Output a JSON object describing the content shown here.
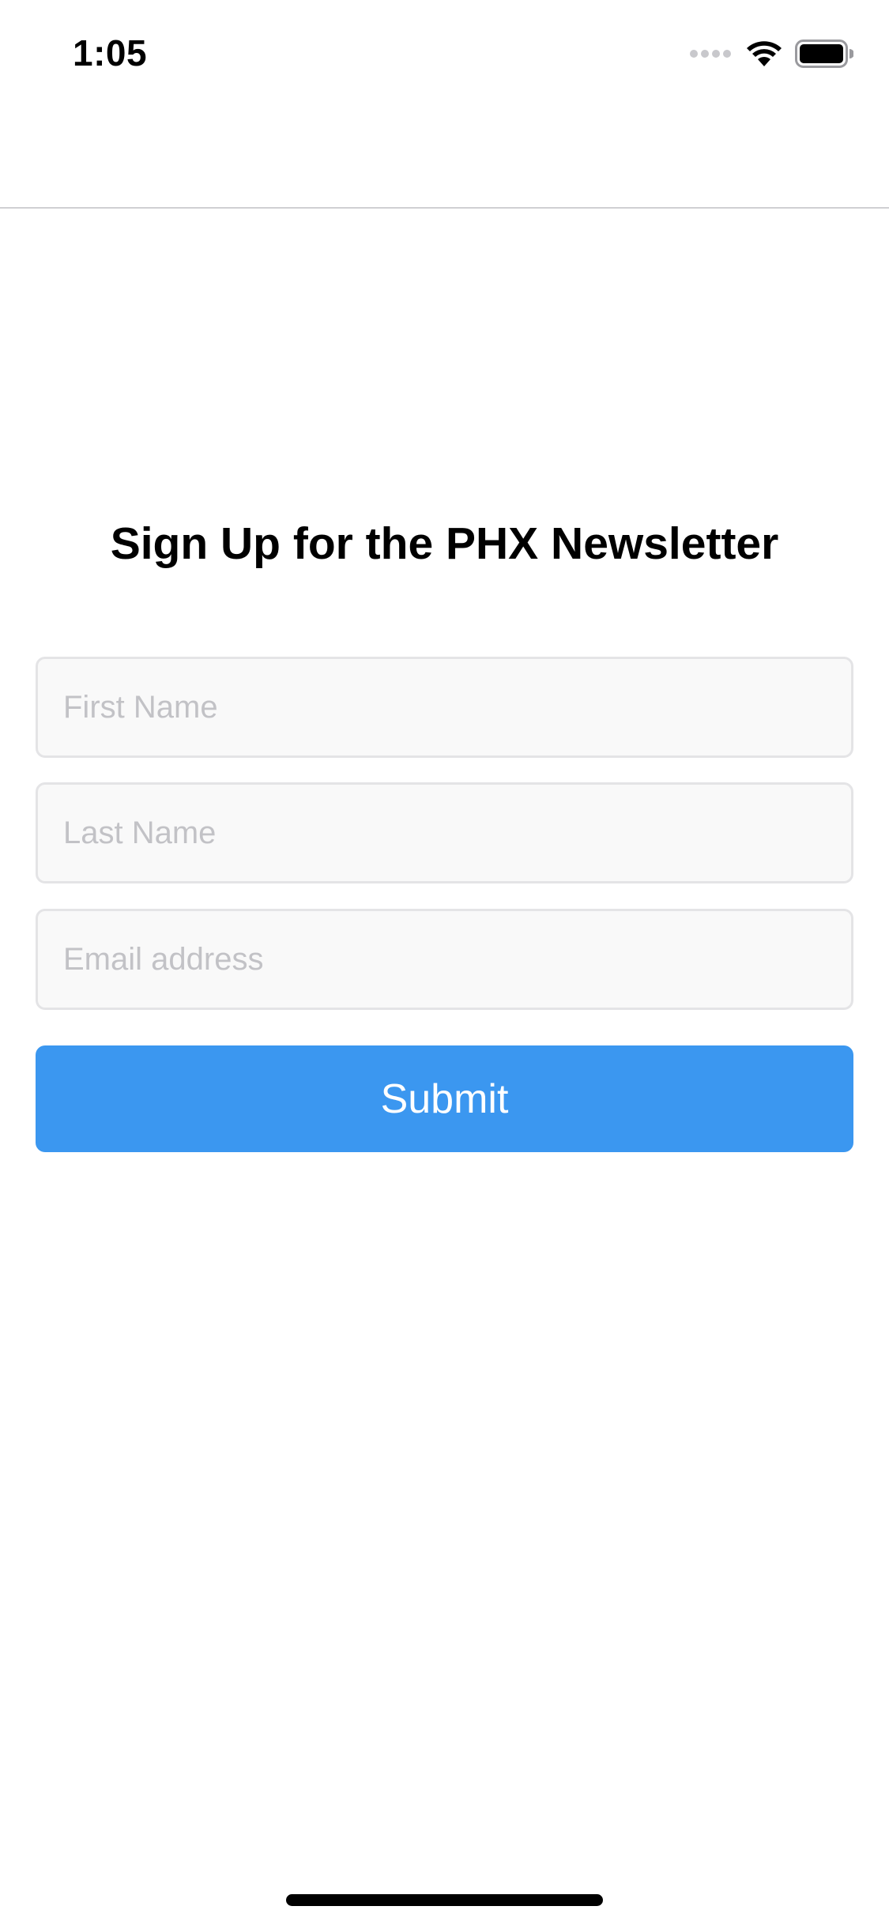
{
  "status_bar": {
    "time": "1:05",
    "icons": [
      "cellular-signal-icon",
      "wifi-icon",
      "battery-icon"
    ]
  },
  "form": {
    "title": "Sign Up for the PHX Newsletter",
    "first_name": {
      "placeholder": "First Name",
      "value": ""
    },
    "last_name": {
      "placeholder": "Last Name",
      "value": ""
    },
    "email": {
      "placeholder": "Email address",
      "value": ""
    },
    "submit_label": "Submit"
  },
  "colors": {
    "accent": "#3b97f0",
    "field_background": "#f9f9f9",
    "field_border": "#e4e4e6",
    "placeholder": "#c2c2c6"
  }
}
